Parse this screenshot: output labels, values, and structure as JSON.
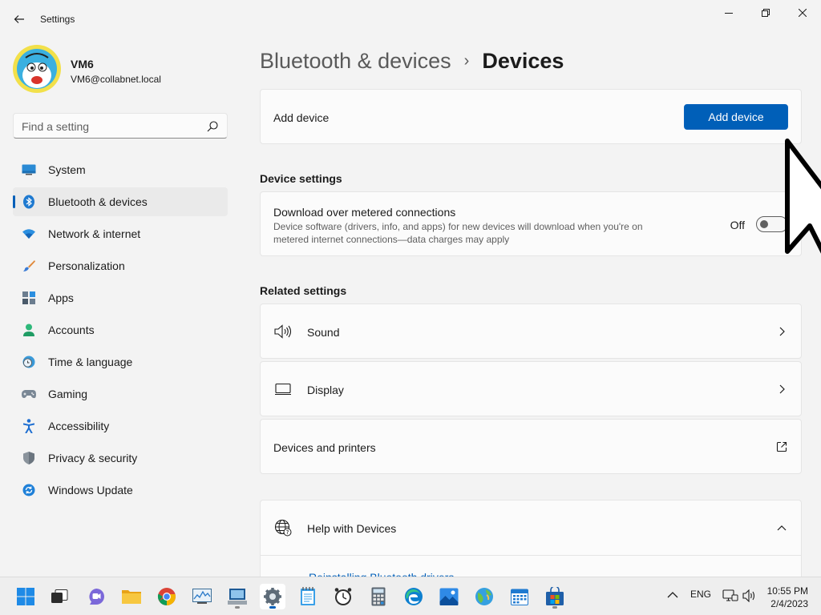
{
  "window": {
    "title": "Settings",
    "minimize_icon": "minimize-icon",
    "restore_icon": "restore-icon",
    "close_icon": "close-icon"
  },
  "profile": {
    "name": "VM6",
    "email": "VM6@collabnet.local"
  },
  "search": {
    "placeholder": "Find a setting"
  },
  "sidebar": {
    "items": [
      {
        "label": "System",
        "icon": "system-icon",
        "active": false
      },
      {
        "label": "Bluetooth & devices",
        "icon": "bluetooth-icon",
        "active": true
      },
      {
        "label": "Network & internet",
        "icon": "network-icon",
        "active": false
      },
      {
        "label": "Personalization",
        "icon": "brush-icon",
        "active": false
      },
      {
        "label": "Apps",
        "icon": "apps-icon",
        "active": false
      },
      {
        "label": "Accounts",
        "icon": "accounts-icon",
        "active": false
      },
      {
        "label": "Time & language",
        "icon": "time-language-icon",
        "active": false
      },
      {
        "label": "Gaming",
        "icon": "gaming-icon",
        "active": false
      },
      {
        "label": "Accessibility",
        "icon": "accessibility-icon",
        "active": false
      },
      {
        "label": "Privacy & security",
        "icon": "shield-icon",
        "active": false
      },
      {
        "label": "Windows Update",
        "icon": "windows-update-icon",
        "active": false
      }
    ]
  },
  "breadcrumb": {
    "parent": "Bluetooth & devices",
    "separator": "›",
    "current": "Devices"
  },
  "add_device": {
    "label": "Add device",
    "button_label": "Add device"
  },
  "device_settings": {
    "section_title": "Device settings",
    "metered": {
      "title": "Download over metered connections",
      "description": "Device software (drivers, info, and apps) for new devices will download when you're on metered internet connections—data charges may apply",
      "state_label": "Off",
      "enabled": false
    }
  },
  "related_settings": {
    "section_title": "Related settings",
    "items": [
      {
        "label": "Sound",
        "icon": "speaker-icon",
        "action_icon": "chevron-right-icon"
      },
      {
        "label": "Display",
        "icon": "display-icon",
        "action_icon": "chevron-right-icon"
      },
      {
        "label": "Devices and printers",
        "icon": "",
        "action_icon": "external-link-icon"
      }
    ]
  },
  "help": {
    "title": "Help with Devices",
    "link": "Reinstalling Bluetooth drivers"
  },
  "taskbar": {
    "apps": [
      "start-icon",
      "task-view-icon",
      "teams-chat-icon",
      "file-explorer-icon",
      "chrome-icon",
      "performance-monitor-icon",
      "remote-desktop-icon",
      "settings-icon",
      "notepad-icon",
      "clock-icon",
      "calculator-icon",
      "edge-icon",
      "photos-icon",
      "maps-icon",
      "calendar-icon",
      "store-icon"
    ],
    "language": "ENG",
    "time": "10:55 PM",
    "date": "2/4/2023"
  },
  "colors": {
    "accent": "#005fb8",
    "background": "#f3f3f3",
    "card": "#fbfbfb"
  }
}
